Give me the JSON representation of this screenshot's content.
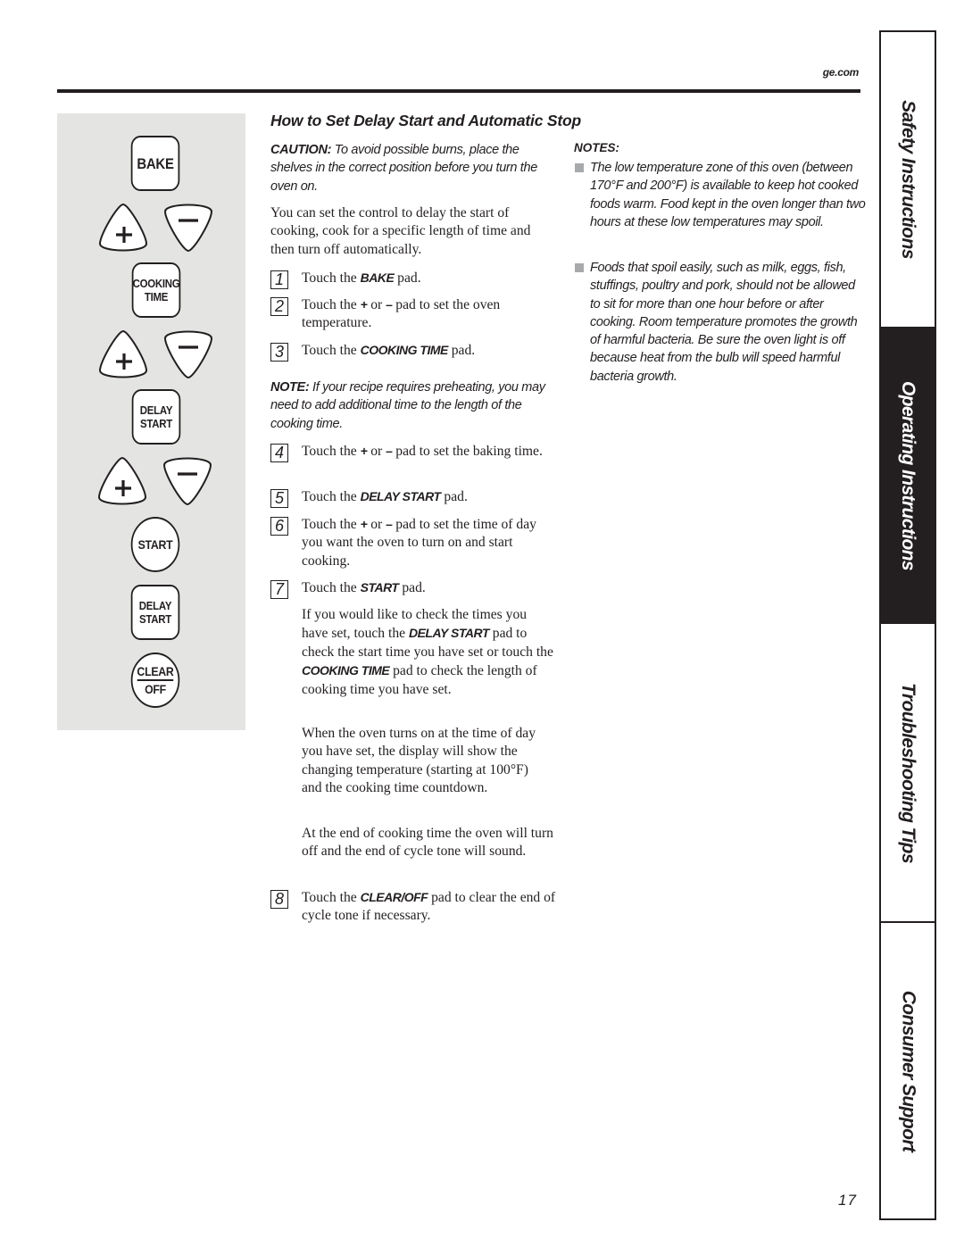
{
  "header": {
    "site_url": "ge.com"
  },
  "control_panel": {
    "pads": {
      "bake": "BAKE",
      "cooking_time": [
        "COOKING",
        "TIME"
      ],
      "delay_start": [
        "DELAY",
        "START"
      ],
      "start": "START",
      "delay_start_2": [
        "DELAY",
        "START"
      ],
      "clear_off": [
        "CLEAR",
        "OFF"
      ]
    },
    "plus_symbol": "+",
    "minus_symbol": "−"
  },
  "section": {
    "title": "How to Set Delay Start and Automatic Stop",
    "caution_label": "CAUTION:",
    "caution_text": " To avoid possible burns, place the shelves in the correct position before you turn the oven on.",
    "intro": "You can set the control to delay the start of cooking, cook for a specific length of time and then turn off automatically.",
    "steps": [
      {
        "num": "1",
        "pre": "Touch the ",
        "key": "BAKE",
        "post": " pad."
      },
      {
        "num": "2",
        "pre": "Touch the ",
        "key": "+",
        "mid": " or ",
        "key2": "–",
        "post": " pad to set the oven temperature."
      },
      {
        "num": "3",
        "pre": "Touch the ",
        "key": "COOKING TIME",
        "post": " pad."
      },
      {
        "num": "4",
        "pre": "Touch the ",
        "key": "+",
        "mid": " or ",
        "key2": "–",
        "post": " pad to set the baking time."
      },
      {
        "num": "5",
        "pre": "Touch the ",
        "key": "DELAY START",
        "post": " pad."
      },
      {
        "num": "6",
        "pre": "Touch the ",
        "key": "+",
        "mid": " or ",
        "key2": "–",
        "post": " pad to set the time of day you want the oven to turn on and start cooking."
      },
      {
        "num": "7",
        "pre": "Touch the ",
        "key": "START",
        "post": " pad."
      },
      {
        "num": "8",
        "pre": "Touch the ",
        "key": "CLEAR/OFF",
        "post": " pad to clear the end of cycle tone if necessary."
      }
    ],
    "note_label": "NOTE:",
    "note_text": " If your recipe requires preheating, you may need to add additional time to the length of the cooking time.",
    "check_times": {
      "p1": "If you would like to check the times you have set, touch the ",
      "k1": "DELAY START",
      "p2": " pad to check the start time you have set or touch the ",
      "k2": "COOKING TIME",
      "p3": " pad to check the length of cooking time you have set."
    },
    "oven_on_text": "When the oven turns on at the time of day you have set, the display will show the changing temperature (starting at 100°F) and the cooking time countdown.",
    "end_text": "At the end of cooking time the oven will turn off and the end of cycle tone will sound."
  },
  "notes": {
    "heading": "NOTES:",
    "items": [
      "The low temperature zone of this oven (between 170°F and 200°F) is available to keep hot cooked foods warm. Food kept in the oven longer than two hours at these low temperatures may spoil.",
      "Foods that spoil easily, such as milk, eggs, fish, stuffings, poultry and pork, should not be allowed to sit for more than one hour before or after cooking. Room temperature promotes the growth of harmful bacteria. Be sure the oven light is off because heat from the bulb will speed harmful bacteria growth."
    ]
  },
  "side_tabs": [
    {
      "label": "Safety Instructions",
      "active": false
    },
    {
      "label": "Operating Instructions",
      "active": true
    },
    {
      "label": "Troubleshooting Tips",
      "active": false
    },
    {
      "label": "Consumer Support",
      "active": false
    }
  ],
  "footer": {
    "page_number": "17"
  }
}
